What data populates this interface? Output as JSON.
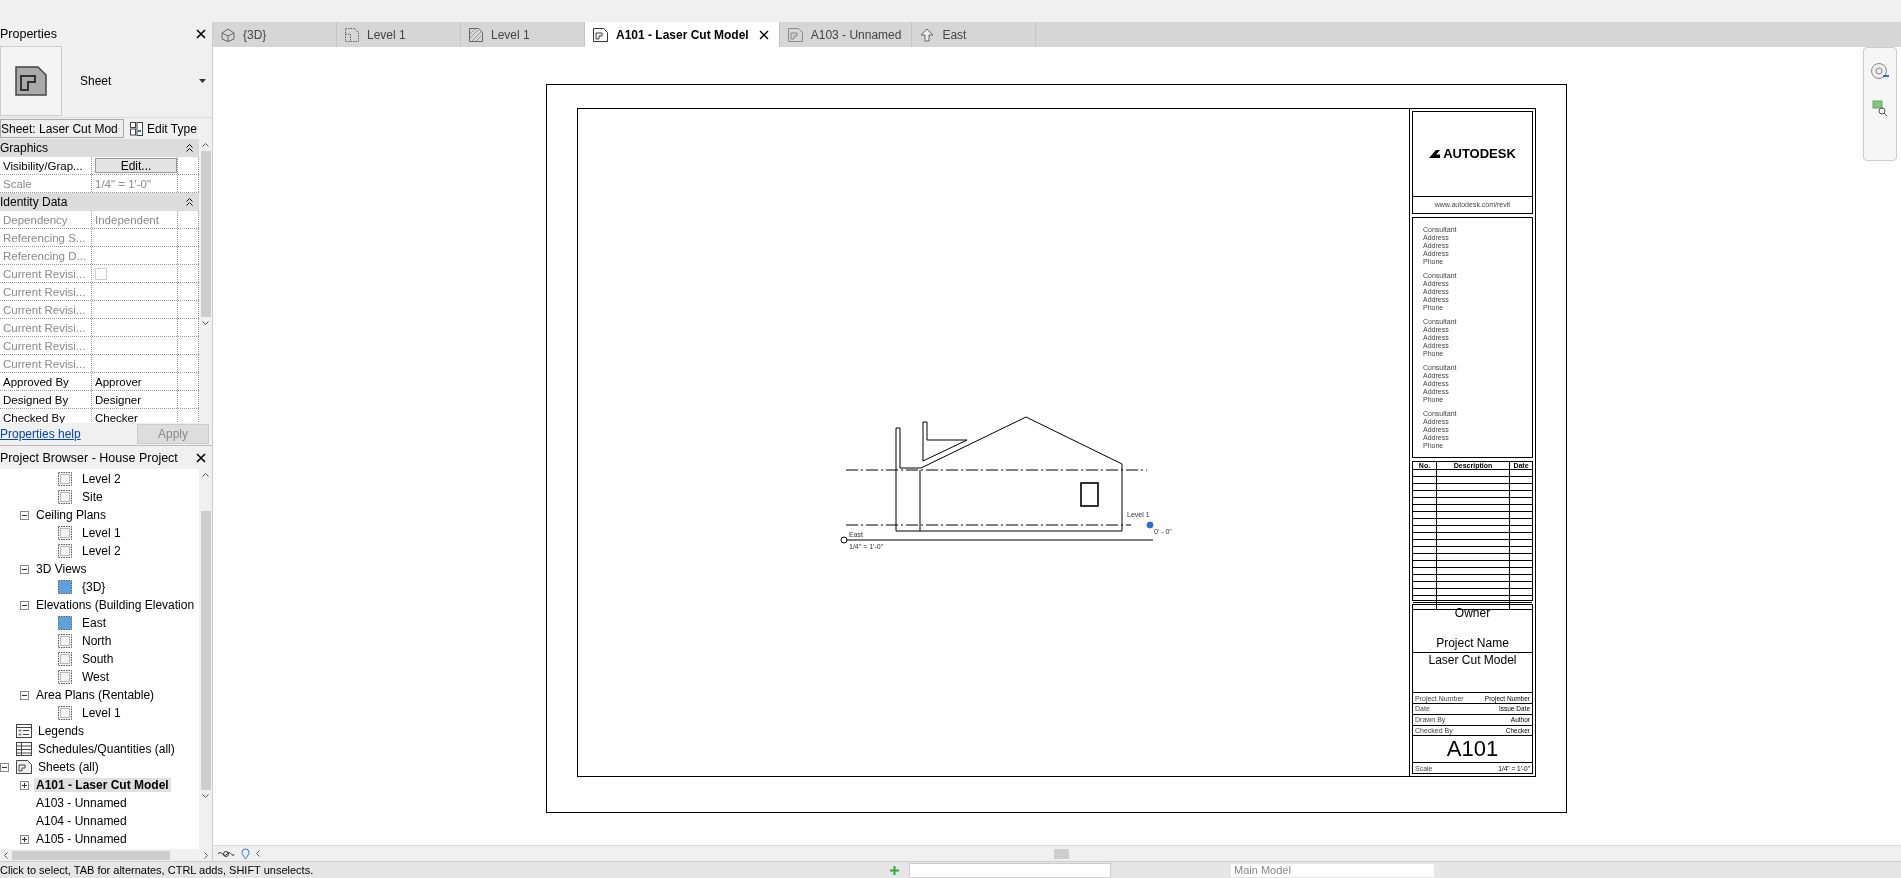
{
  "properties_panel": {
    "title": "Properties",
    "type_name": "Sheet",
    "instance_selector": "Sheet: Laser Cut Mod",
    "edit_type": "Edit Type",
    "sections": [
      {
        "title": "Graphics",
        "expanded": true,
        "rows": [
          {
            "kind": "button",
            "name": "Visibility/Grap...",
            "value": "Edit...",
            "disabled": false
          },
          {
            "kind": "text",
            "name": "Scale",
            "value": "1/4\" = 1'-0\"",
            "disabled": true
          }
        ]
      },
      {
        "title": "Identity Data",
        "expanded": true,
        "rows": [
          {
            "kind": "text",
            "name": "Dependency",
            "value": "Independent",
            "disabled": true
          },
          {
            "kind": "text",
            "name": "Referencing S...",
            "value": "",
            "disabled": true
          },
          {
            "kind": "text",
            "name": "Referencing D...",
            "value": "",
            "disabled": true
          },
          {
            "kind": "checkbox",
            "name": "Current Revisi...",
            "checked": false,
            "disabled": true
          },
          {
            "kind": "text",
            "name": "Current Revisi...",
            "value": "",
            "disabled": true
          },
          {
            "kind": "text",
            "name": "Current Revisi...",
            "value": "",
            "disabled": true
          },
          {
            "kind": "text",
            "name": "Current Revisi...",
            "value": "",
            "disabled": true
          },
          {
            "kind": "text",
            "name": "Current Revisi...",
            "value": "",
            "disabled": true
          },
          {
            "kind": "text",
            "name": "Current Revisi...",
            "value": "",
            "disabled": true
          },
          {
            "kind": "text",
            "name": "Approved By",
            "value": "Approver",
            "disabled": false
          },
          {
            "kind": "text",
            "name": "Designed By",
            "value": "Designer",
            "disabled": false
          },
          {
            "kind": "text",
            "name": "Checked By",
            "value": "Checker",
            "disabled": false
          }
        ]
      }
    ],
    "help_link": "Properties help",
    "apply_button": {
      "label": "Apply",
      "disabled": true
    }
  },
  "project_browser": {
    "title": "Project Browser - House Project",
    "tree": [
      {
        "children": [
          {
            "children": [
              {
                "label": "Level 2",
                "kind": "view",
                "open": false,
                "selected": false
              },
              {
                "label": "Site",
                "kind": "view",
                "open": false,
                "selected": false
              }
            ]
          },
          {
            "label": "Ceiling Plans",
            "expanded": true,
            "selected": false,
            "children": [
              {
                "label": "Level 1",
                "kind": "view",
                "open": false,
                "selected": false
              },
              {
                "label": "Level 2",
                "kind": "view",
                "open": false,
                "selected": false
              }
            ]
          },
          {
            "label": "3D Views",
            "expanded": true,
            "selected": false,
            "children": [
              {
                "label": "{3D}",
                "kind": "view",
                "open": true,
                "selected": false
              }
            ]
          },
          {
            "label": "Elevations (Building Elevation",
            "expanded": true,
            "selected": false,
            "children": [
              {
                "label": "East",
                "kind": "view",
                "open": true,
                "selected": false
              },
              {
                "label": "North",
                "kind": "view",
                "open": false,
                "selected": false
              },
              {
                "label": "South",
                "kind": "view",
                "open": false,
                "selected": false
              },
              {
                "label": "West",
                "kind": "view",
                "open": false,
                "selected": false
              }
            ]
          },
          {
            "label": "Area Plans (Rentable)",
            "expanded": true,
            "selected": false,
            "children": [
              {
                "label": "Level 1",
                "kind": "view",
                "open": false,
                "selected": false
              }
            ]
          }
        ]
      },
      {
        "label": "Legends",
        "kind": "legends",
        "selected": false
      },
      {
        "label": "Schedules/Quantities (all)",
        "kind": "schedules",
        "selected": false
      },
      {
        "label": "Sheets (all)",
        "kind": "sheets",
        "expanded": true,
        "selected": false,
        "children": [
          {
            "label": "A101 - Laser Cut Model",
            "expanded": false,
            "selected": true
          },
          {
            "label": "A103 - Unnamed",
            "selected": false
          },
          {
            "label": "A104 - Unnamed",
            "selected": false
          },
          {
            "label": "A105 - Unnamed",
            "expanded": false,
            "selected": false
          }
        ]
      }
    ]
  },
  "tabs": [
    {
      "label": "{3D}",
      "kind": "perspective",
      "selected": false
    },
    {
      "label": "Level 1",
      "kind": "plan",
      "selected": false
    },
    {
      "label": "Level 1",
      "kind": "ceiling",
      "selected": false
    },
    {
      "label": "A101 - Laser Cut Model",
      "kind": "sheet",
      "selected": true
    },
    {
      "label": "A103 - Unnamed",
      "kind": "sheet",
      "selected": false
    },
    {
      "label": "East",
      "kind": "elevation",
      "selected": false
    }
  ],
  "sheet": {
    "logo": "AUTODESK",
    "url": "www.autodesk.com/revit",
    "consultants": [
      [
        "Consultant",
        "Address",
        "Address",
        "Address",
        "Phone"
      ],
      [
        "Consultant",
        "Address",
        "Address",
        "Address",
        "Phone"
      ],
      [
        "Consultant",
        "Address",
        "Address",
        "Address",
        "Phone"
      ],
      [
        "Consultant",
        "Address",
        "Address",
        "Address",
        "Phone"
      ],
      [
        "Consultant",
        "Address",
        "Address",
        "Address",
        "Phone"
      ]
    ],
    "revision_columns": [
      "No.",
      "Description",
      "Date"
    ],
    "owner": "Owner",
    "project_name": "Project Name",
    "sheet_name": "Laser Cut Model",
    "fields": [
      {
        "label": "Project Number",
        "value": "Project Number"
      },
      {
        "label": "Date",
        "value": "Issue Date"
      },
      {
        "label": "Drawn By",
        "value": "Author"
      },
      {
        "label": "Checked By",
        "value": "Checker"
      }
    ],
    "sheet_number": "A101",
    "scale_label": "Scale",
    "scale": "1/4\" = 1'-0\"",
    "view": {
      "level_name": "Level 1",
      "level_elevation": "0' - 0\"",
      "view_name": "East",
      "view_scale": "1/4\" = 1'-0\""
    }
  },
  "status_bar": {
    "message": "Click to select, TAB for alternates, CTRL adds, SHIFT unselects.",
    "workset": "Main Model"
  }
}
